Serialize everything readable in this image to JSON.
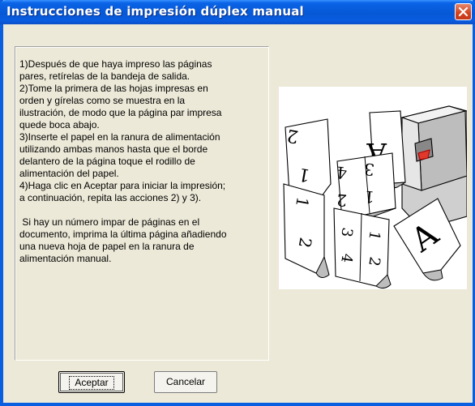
{
  "window": {
    "title": "Instrucciones de impresión dúplex manual",
    "close_icon": "close-x-icon"
  },
  "instructions": {
    "text": "1)Después de que haya impreso las páginas\npares, retírelas de la bandeja de salida.\n2)Tome la primera de las hojas impresas en\norden y gírelas como se muestra en la\nilustración, de modo que la página par impresa\nquede boca abajo.\n3)Inserte el papel en la ranura de alimentación\nutilizando ambas manos hasta que el borde\ndelantero de la página toque el rodillo de\nalimentación del papel.\n4)Haga clic en Aceptar para iniciar la impresión;\na continuación, repita las acciones 2) y 3).\n\n Si hay un número impar de páginas en el\ndocumento, imprima la última página añadiendo\nuna nueva hoja de papel en la ranura de\nalimentación manual."
  },
  "illustration": {
    "page_numbers": [
      "2",
      "1",
      "4",
      "3",
      "2",
      "1",
      "1",
      "2",
      "3",
      "4",
      "1",
      "2",
      "A",
      "A"
    ]
  },
  "buttons": {
    "ok_label": "Aceptar",
    "cancel_label": "Cancelar"
  }
}
